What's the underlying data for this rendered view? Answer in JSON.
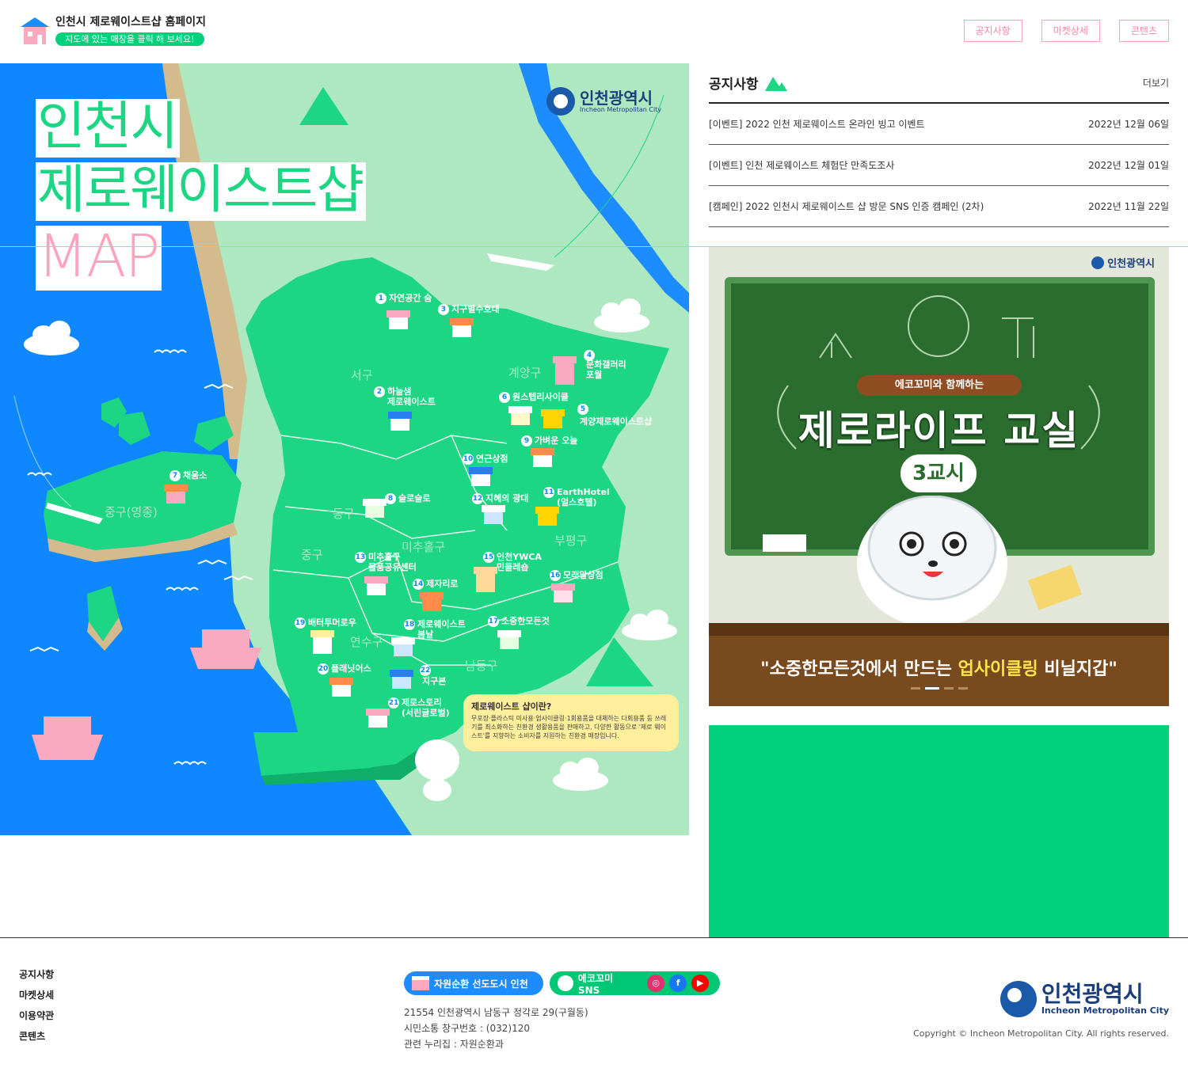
{
  "header": {
    "site_title": "인천시 제로웨이스트샵 홈페이지",
    "site_sub": "지도에 있는 매장을 클릭 해 보세요!",
    "nav": [
      "공지사항",
      "마켓상세",
      "콘텐츠"
    ]
  },
  "map": {
    "title_lines": [
      "인천시",
      "제로웨이스트샵",
      "MAP"
    ],
    "city_logo_ko": "인천광역시",
    "city_logo_en": "Incheon Metropolitan City",
    "districts": [
      "서구",
      "계양구",
      "중구(영종)",
      "동구",
      "중구",
      "미추홀구",
      "부평구",
      "연수구",
      "남동구"
    ],
    "stores": [
      {
        "num": "1",
        "name": "자연공간 숨"
      },
      {
        "num": "2",
        "name": "하늘샘\n제로웨이스트"
      },
      {
        "num": "3",
        "name": "지구별수호대"
      },
      {
        "num": "4",
        "name": "문화갤러리\n포월"
      },
      {
        "num": "5",
        "name": "계양제로웨이스트샵"
      },
      {
        "num": "6",
        "name": "원스텝리사이클"
      },
      {
        "num": "7",
        "name": "채움소"
      },
      {
        "num": "8",
        "name": "슬로슬로"
      },
      {
        "num": "9",
        "name": "가벼운 오늘"
      },
      {
        "num": "10",
        "name": "연근상점"
      },
      {
        "num": "11",
        "name": "EarthHotel\n(얼스호텔)"
      },
      {
        "num": "12",
        "name": "지혜의 광대"
      },
      {
        "num": "13",
        "name": "미추홀구\n물품공유센터"
      },
      {
        "num": "14",
        "name": "제자리로"
      },
      {
        "num": "15",
        "name": "인천YWCA\n민들레숍"
      },
      {
        "num": "16",
        "name": "모래알상점"
      },
      {
        "num": "17",
        "name": "소중한모든것"
      },
      {
        "num": "18",
        "name": "제로웨이스트\n봄날"
      },
      {
        "num": "19",
        "name": "배터투머로우"
      },
      {
        "num": "20",
        "name": "플래닛어스"
      },
      {
        "num": "21",
        "name": "제로스토리\n(서린글로벌)"
      },
      {
        "num": "22",
        "name": "지구본"
      }
    ],
    "info_title": "제로웨이스트 샵이란?",
    "info_desc": "무포장·플라스틱 미사용·업사이클링·1회용품을 대체하는 다회용품 등 쓰레기를 최소화하는 친환경 생활용품을 판매하고, 다양한 활동으로 '제로 웨이스트'를 지향하는 소비자를 지원하는 친환경 매장입니다."
  },
  "notice": {
    "title": "공지사항",
    "more": "더보기",
    "items": [
      {
        "text": "[이벤트] 2022 인천 제로웨이스트 온라인 빙고 이벤트",
        "date": "2022년 12월 06일"
      },
      {
        "text": "[이벤트] 인천 제로웨이스트 체험단 만족도조사",
        "date": "2022년 12월 01일"
      },
      {
        "text": "[캠페인] 2022 인천시 제로웨이스트 샵 방문 SNS 인증 캠페인 (2차)",
        "date": "2022년 11월 22일"
      }
    ]
  },
  "banner": {
    "logo": "인천광역시",
    "sub": "에코꼬미와 함께하는",
    "main": "제로라이프 교실",
    "badge": "3교시",
    "caption_a": "\"소중한모든것",
    "caption_b": "에서 만드는 ",
    "caption_c": "업사이클링",
    "caption_d": " 비닐지갑\""
  },
  "footer": {
    "links": [
      "공지사항",
      "마켓상세",
      "이용약관",
      "콘텐츠"
    ],
    "pill_1": "자원순환 선도도시 인천",
    "pill_2": "에코꼬미 SNS",
    "addr": "21554 인천광역시 남동구 정각로 29(구월동)",
    "tel": "시민소통 창구번호 : (032)120",
    "dept": "관련 누리집 : 자원순환과",
    "logo_ko": "인천광역시",
    "logo_en": "Incheon Metropolitan City",
    "copyright": "Copyright © Incheon Metropolitan City. All rights reserved."
  }
}
